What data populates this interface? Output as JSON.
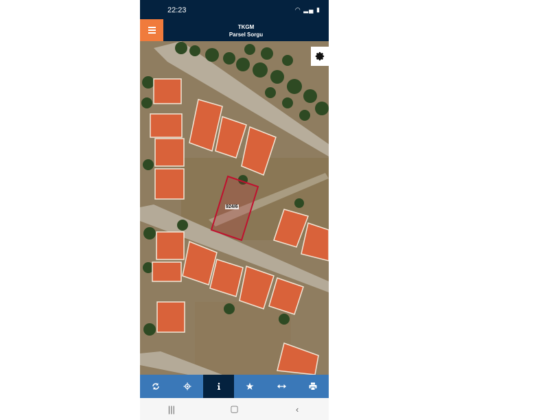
{
  "status_bar": {
    "time": "22:23",
    "icons": [
      "wifi-icon",
      "signal-icon",
      "battery-icon"
    ]
  },
  "app_bar": {
    "title": "TKGM",
    "subtitle": "Parsel Sorgu",
    "menu_icon": "hamburger-menu-icon",
    "accent": "#f07b3c",
    "background": "#04223f"
  },
  "map": {
    "parcel_label": "924/6",
    "parcel_color": "#c0102e",
    "settings_icon": "gear-icon"
  },
  "toolbar": {
    "background": "#3a78b8",
    "active_index": 2,
    "tools": [
      {
        "name": "refresh-icon"
      },
      {
        "name": "locate-icon"
      },
      {
        "name": "info-icon"
      },
      {
        "name": "star-icon"
      },
      {
        "name": "measure-icon"
      },
      {
        "name": "print-icon"
      }
    ]
  },
  "nav_bar": {
    "buttons": [
      "recent-apps-icon",
      "home-icon",
      "back-icon"
    ]
  }
}
